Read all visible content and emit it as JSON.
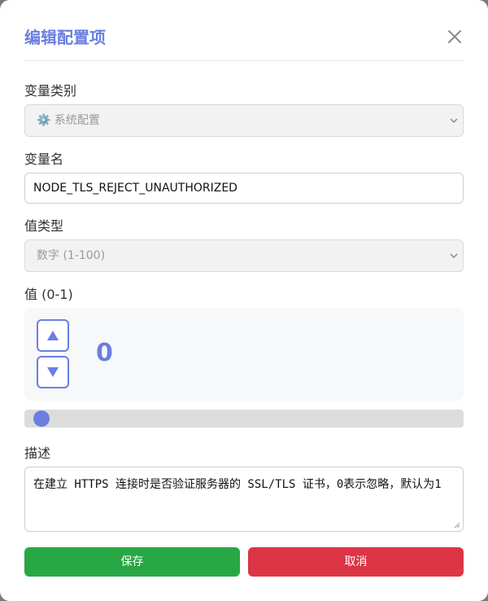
{
  "dialog": {
    "title": "编辑配置项"
  },
  "fields": {
    "category": {
      "label": "变量类别",
      "value": "⚙️ 系统配置"
    },
    "name": {
      "label": "变量名",
      "value": "NODE_TLS_REJECT_UNAUTHORIZED"
    },
    "value_type": {
      "label": "值类型",
      "value": "数字 (1-100)"
    },
    "value": {
      "label": "值 (0-1)",
      "current": "0",
      "slider_fraction": 0.0
    },
    "description": {
      "label": "描述",
      "value": "在建立 HTTPS 连接时是否验证服务器的 SSL/TLS 证书，0表示忽略，默认为1"
    }
  },
  "actions": {
    "save_label": "保存",
    "cancel_label": "取消"
  },
  "icons": {
    "close": "close-icon",
    "up": "arrow-up-icon",
    "down": "arrow-down-icon",
    "chevron": "chevron-down-icon"
  },
  "colors": {
    "accent": "#6a7fe0",
    "save": "#28a745",
    "cancel": "#dc3545"
  }
}
